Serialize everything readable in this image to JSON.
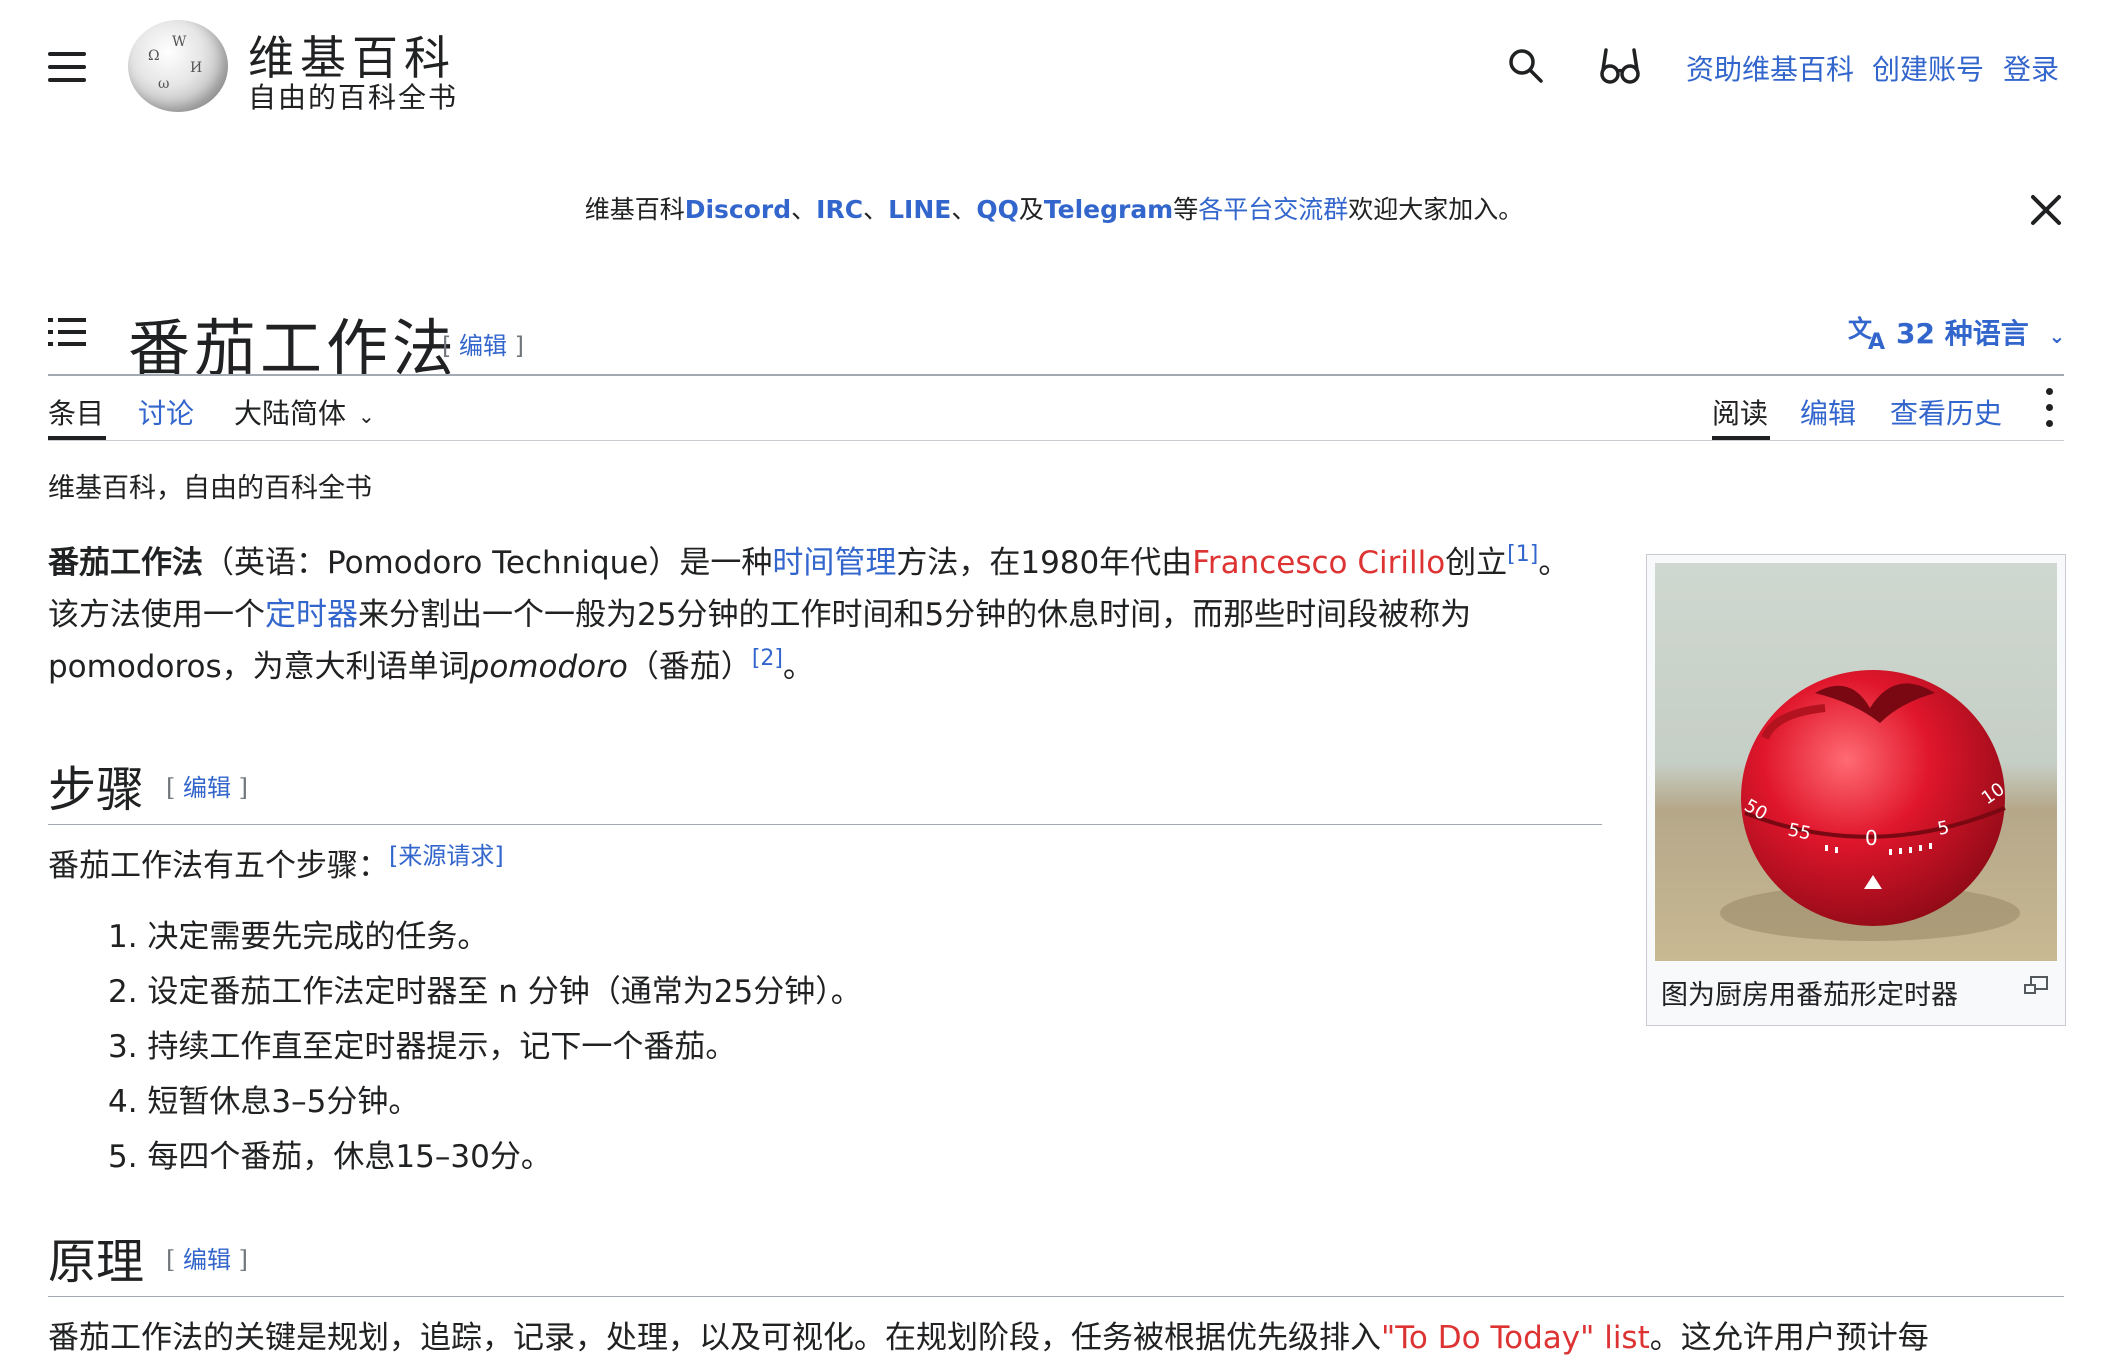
{
  "header": {
    "logo_title": "维基百科",
    "logo_subtitle": "自由的百科全书",
    "links": [
      "资助维基百科",
      "创建账号",
      "登录"
    ]
  },
  "notice": {
    "prefix": "维基百科",
    "discord": "Discord",
    "sep1": "、",
    "irc": "IRC",
    "sep2": "、",
    "line": "LINE",
    "sep3": "、",
    "qq": "QQ",
    "and": "及",
    "telegram": "Telegram",
    "etc": "等",
    "groups_link": "各平台交流群",
    "suffix": "欢迎大家加入。"
  },
  "article": {
    "title": "番茄工作法",
    "edit_label": "编辑",
    "language_button": "32 种语言"
  },
  "tabs": {
    "left": [
      "条目",
      "讨论",
      "大陆简体"
    ],
    "right": [
      "阅读",
      "编辑",
      "查看历史"
    ]
  },
  "tagline": "维基百科，自由的百科全书",
  "intro": {
    "bold": "番茄工作法",
    "t1": "（英语：Pomodoro Technique）是一种",
    "link_time": "时间管理",
    "t2": "方法，在1980年代由",
    "link_author": "Francesco Cirillo",
    "t3": "创立",
    "ref1": "[1]",
    "t4": "。 该方法使用一个",
    "link_timer": "定时器",
    "t5": "来分割出一个一般为25分钟的工作时间和5分钟的休息时间，而那些时间段被称为pomodoros，为意大利语单词",
    "italic": "pomodoro",
    "t6": "（番茄）",
    "ref2": "[2]",
    "t7": "。"
  },
  "section_steps": {
    "heading": "步骤",
    "edit_label": "编辑",
    "lead": "番茄工作法有五个步骤：",
    "citation": "[来源请求]",
    "items": [
      "1. 决定需要先完成的任务。",
      "2. 设定番茄工作法定时器至 n 分钟（通常为25分钟）。",
      "3. 持续工作直至定时器提示，记下一个番茄。",
      "4. 短暂休息3–5分钟。",
      "5. 每四个番茄，休息15–30分。"
    ]
  },
  "section_principle": {
    "heading": "原理",
    "edit_label": "编辑",
    "text1": "番茄工作法的关键是规划，追踪，记录，处理，以及可视化。在规划阶段，任务被根据优先级排入",
    "link": "\"To Do Today\" list",
    "text2": "。这允许用户预计每"
  },
  "thumbnail": {
    "caption": "图为厨房用番茄形定时器",
    "dial_marks": [
      "50",
      "55",
      "0",
      "5",
      "10"
    ]
  }
}
